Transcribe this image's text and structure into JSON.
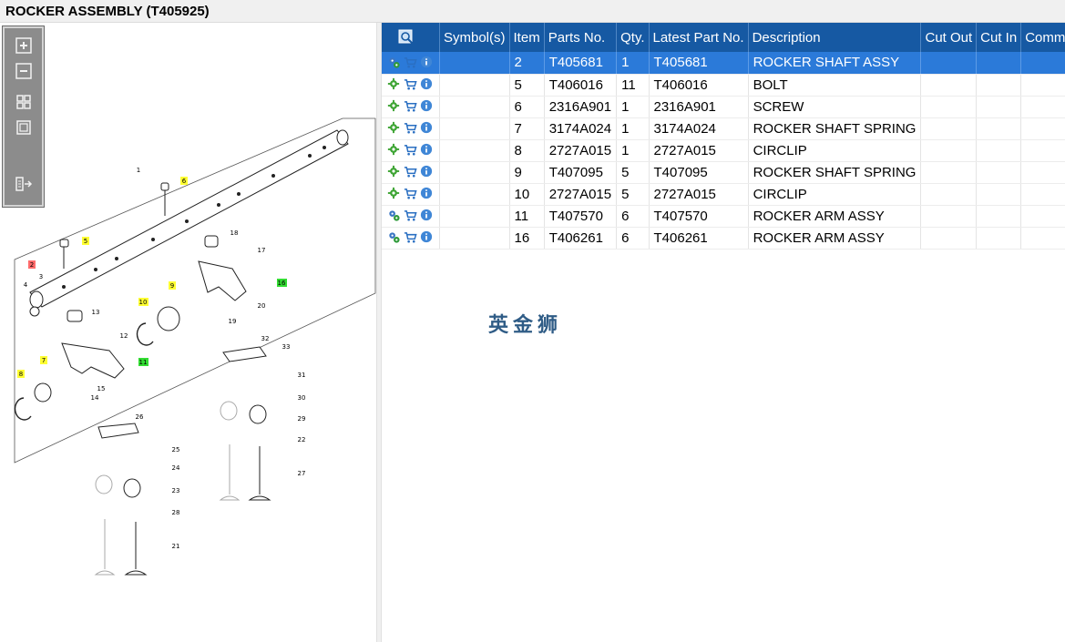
{
  "window": {
    "title": "ROCKER ASSEMBLY (T405925)"
  },
  "toolbar": {
    "buttons": [
      {
        "name": "zoom-in-icon"
      },
      {
        "name": "zoom-out-icon"
      },
      {
        "name": "fit-all-icon"
      },
      {
        "name": "fit-window-icon"
      },
      {
        "name": "export-icon"
      }
    ]
  },
  "diagram": {
    "callouts": [
      {
        "label": "1"
      },
      {
        "label": "2"
      },
      {
        "label": "3"
      },
      {
        "label": "4"
      },
      {
        "label": "5"
      },
      {
        "label": "6"
      },
      {
        "label": "7"
      },
      {
        "label": "8"
      },
      {
        "label": "9"
      },
      {
        "label": "10"
      },
      {
        "label": "11"
      },
      {
        "label": "12"
      },
      {
        "label": "13"
      },
      {
        "label": "14"
      },
      {
        "label": "15"
      },
      {
        "label": "16"
      },
      {
        "label": "17"
      },
      {
        "label": "18"
      },
      {
        "label": "19"
      },
      {
        "label": "20"
      },
      {
        "label": "21"
      },
      {
        "label": "22"
      },
      {
        "label": "23"
      },
      {
        "label": "24"
      },
      {
        "label": "25"
      },
      {
        "label": "26"
      },
      {
        "label": "27"
      },
      {
        "label": "28"
      },
      {
        "label": "29"
      },
      {
        "label": "30"
      },
      {
        "label": "31"
      },
      {
        "label": "32"
      },
      {
        "label": "33"
      }
    ],
    "highlight_colors": {
      "selected": "#ff6b6b",
      "part": "#ffff33",
      "assembly": "#33dd33"
    }
  },
  "table": {
    "columns": [
      "Symbol(s)",
      "Item",
      "Parts No.",
      "Qty.",
      "Latest Part No.",
      "Description",
      "Cut Out",
      "Cut In",
      "Comment"
    ],
    "header_icon": "search-diagram-icon",
    "rows": [
      {
        "type": "assembly",
        "item": "2",
        "parts_no": "T405681",
        "qty": "1",
        "latest": "T405681",
        "description": "ROCKER SHAFT ASSY",
        "selected": true
      },
      {
        "type": "part",
        "item": "5",
        "parts_no": "T406016",
        "qty": "11",
        "latest": "T406016",
        "description": "BOLT"
      },
      {
        "type": "part",
        "item": "6",
        "parts_no": "2316A901",
        "qty": "1",
        "latest": "2316A901",
        "description": "SCREW"
      },
      {
        "type": "part",
        "item": "7",
        "parts_no": "3174A024",
        "qty": "1",
        "latest": "3174A024",
        "description": "ROCKER SHAFT SPRING"
      },
      {
        "type": "part",
        "item": "8",
        "parts_no": "2727A015",
        "qty": "1",
        "latest": "2727A015",
        "description": "CIRCLIP"
      },
      {
        "type": "part",
        "item": "9",
        "parts_no": "T407095",
        "qty": "5",
        "latest": "T407095",
        "description": "ROCKER SHAFT SPRING"
      },
      {
        "type": "part",
        "item": "10",
        "parts_no": "2727A015",
        "qty": "5",
        "latest": "2727A015",
        "description": "CIRCLIP"
      },
      {
        "type": "assembly",
        "item": "11",
        "parts_no": "T407570",
        "qty": "6",
        "latest": "T407570",
        "description": "ROCKER ARM ASSY"
      },
      {
        "type": "assembly",
        "item": "16",
        "parts_no": "T406261",
        "qty": "6",
        "latest": "T406261",
        "description": "ROCKER ARM ASSY"
      }
    ],
    "colors": {
      "header": "#1659a3",
      "selected_row": "#2b7ad9"
    }
  },
  "watermark": {
    "text": "英金狮"
  }
}
